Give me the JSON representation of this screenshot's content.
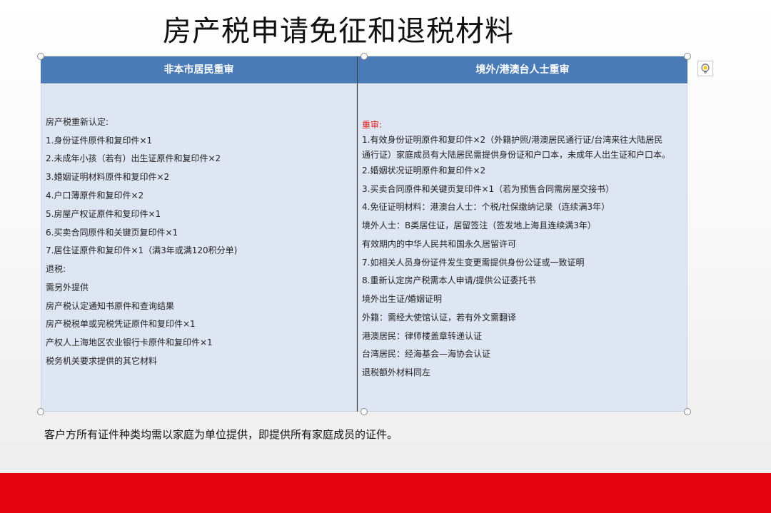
{
  "title": "房产税申请免征和退税材料",
  "colors": {
    "header_blue": "#4a7bb7",
    "body_blue": "#dde6f2",
    "accent_red": "#e4040f",
    "text_red": "#e0201c"
  },
  "left_column": {
    "header": "非本市居民重审",
    "lines": [
      "房产税重新认定:",
      "1.身份证件原件和复印件×1",
      "2.未成年小孩（若有）出生证原件和复印件×2",
      "3.婚姻证明材料原件和复印件×2",
      "4.户口薄原件和复印件×2",
      "5.房屋产权证原件和复印件×1",
      "6.买卖合同原件和关键页复印件×1",
      "7.居住证原件和复印件×1（满3年或满120积分单)",
      "退税:",
      "需另外提供",
      "房产税认定通知书原件和查询结果",
      "房产税税单或完税凭证原件和复印件×1",
      "产权人上海地区农业银行卡原件和复印件×1",
      "税务机关要求提供的其它材料"
    ]
  },
  "right_column": {
    "header": "境外/港澳台人士重审",
    "lines": [
      "重审:",
      "1.有效身份证明原件和复印件×2（外籍护照/港澳居民通行证/台湾来往大陆居民",
      "通行证）家庭成员有大陆居民需提供身份证和户口本，未成年人出生证和户口本。",
      "2.婚姻状况证明原件和复印件×2",
      "3.买卖合同原件和关键页复印件×1（若为预售合同需房屋交接书）",
      "4.免征证明材料：港澳台人士：个税/社保缴纳记录（连续满3年）",
      "  境外人士：B类居住证，居留签注（签发地上海且连续满3年）",
      "有效期内的中华人民共和国永久居留许可",
      "7.如相关人员身份证件发生变更需提供身份公证或一致证明",
      "8.重新认定房产税需本人申请/提供公证委托书",
      "境外出生证/婚姻证明",
      "外籍：需经大使馆认证，若有外文需翻译",
      "港澳居民：律师楼盖章转递认证",
      "台湾居民：经海基会—海协会认证",
      "退税额外材料同左"
    ]
  },
  "footnote": "客户方所有证件种类均需以家庭为单位提供，即提供所有家庭成员的证件。",
  "icons": {
    "design_ideas": "lightbulb-icon",
    "selection_handle": "resize-handle"
  }
}
